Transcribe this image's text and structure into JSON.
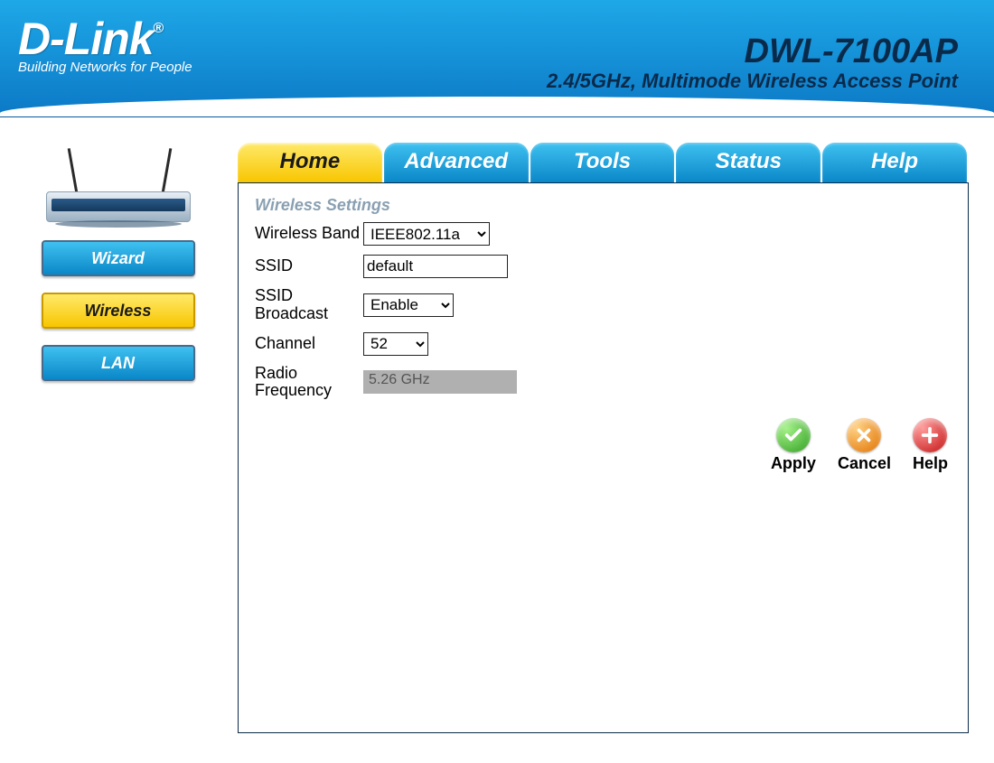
{
  "brand": {
    "name": "D-Link",
    "reg": "®",
    "tagline": "Building Networks for People"
  },
  "product": {
    "model": "DWL-7100AP",
    "subtitle": "2.4/5GHz, Multimode Wireless Access Point"
  },
  "sidebar": {
    "wizard": "Wizard",
    "wireless": "Wireless",
    "lan": "LAN"
  },
  "tabs": {
    "home": "Home",
    "advanced": "Advanced",
    "tools": "Tools",
    "status": "Status",
    "help": "Help"
  },
  "section": {
    "title": "Wireless Settings",
    "labels": {
      "band": "Wireless Band",
      "ssid": "SSID",
      "broadcast": "SSID Broadcast",
      "channel": "Channel",
      "freq": "Radio Frequency"
    },
    "values": {
      "band": "IEEE802.11a",
      "ssid": "default",
      "broadcast": "Enable",
      "channel": "52",
      "freq": "5.26 GHz"
    }
  },
  "actions": {
    "apply": "Apply",
    "cancel": "Cancel",
    "help": "Help"
  }
}
